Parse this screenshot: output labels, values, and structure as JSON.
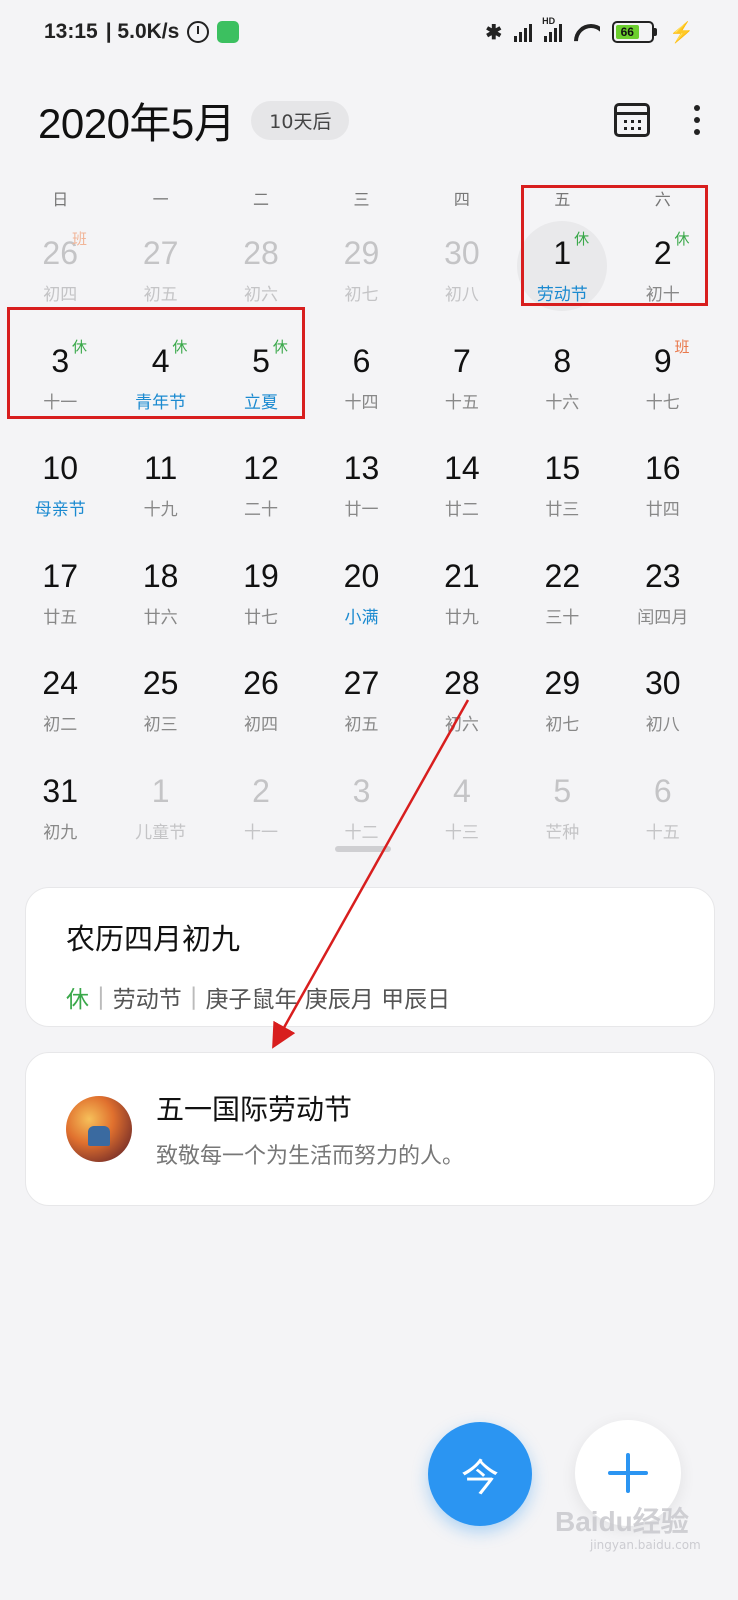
{
  "status_bar": {
    "time": "13:15",
    "net_speed": "| 5.0K/s",
    "battery": "66",
    "hd_label": "HD"
  },
  "header": {
    "title": "2020年5月",
    "countdown": "10天后"
  },
  "weekdays": [
    "日",
    "一",
    "二",
    "三",
    "四",
    "五",
    "六"
  ],
  "weeks": [
    [
      {
        "num": "26",
        "lunar": "初四",
        "tag": "班",
        "other": true
      },
      {
        "num": "27",
        "lunar": "初五",
        "other": true
      },
      {
        "num": "28",
        "lunar": "初六",
        "other": true
      },
      {
        "num": "29",
        "lunar": "初七",
        "other": true
      },
      {
        "num": "30",
        "lunar": "初八",
        "other": true
      },
      {
        "num": "1",
        "lunar": "劳动节",
        "tag": "休",
        "festival": true,
        "selected": true
      },
      {
        "num": "2",
        "lunar": "初十",
        "tag": "休"
      }
    ],
    [
      {
        "num": "3",
        "lunar": "十一",
        "tag": "休"
      },
      {
        "num": "4",
        "lunar": "青年节",
        "tag": "休",
        "festival": true
      },
      {
        "num": "5",
        "lunar": "立夏",
        "tag": "休",
        "festival": true
      },
      {
        "num": "6",
        "lunar": "十四"
      },
      {
        "num": "7",
        "lunar": "十五"
      },
      {
        "num": "8",
        "lunar": "十六"
      },
      {
        "num": "9",
        "lunar": "十七",
        "tag": "班"
      }
    ],
    [
      {
        "num": "10",
        "lunar": "母亲节",
        "festival": true
      },
      {
        "num": "11",
        "lunar": "十九"
      },
      {
        "num": "12",
        "lunar": "二十"
      },
      {
        "num": "13",
        "lunar": "廿一"
      },
      {
        "num": "14",
        "lunar": "廿二"
      },
      {
        "num": "15",
        "lunar": "廿三"
      },
      {
        "num": "16",
        "lunar": "廿四"
      }
    ],
    [
      {
        "num": "17",
        "lunar": "廿五"
      },
      {
        "num": "18",
        "lunar": "廿六"
      },
      {
        "num": "19",
        "lunar": "廿七"
      },
      {
        "num": "20",
        "lunar": "小满",
        "festival": true
      },
      {
        "num": "21",
        "lunar": "廿九"
      },
      {
        "num": "22",
        "lunar": "三十"
      },
      {
        "num": "23",
        "lunar": "闰四月"
      }
    ],
    [
      {
        "num": "24",
        "lunar": "初二"
      },
      {
        "num": "25",
        "lunar": "初三"
      },
      {
        "num": "26",
        "lunar": "初四"
      },
      {
        "num": "27",
        "lunar": "初五"
      },
      {
        "num": "28",
        "lunar": "初六"
      },
      {
        "num": "29",
        "lunar": "初七"
      },
      {
        "num": "30",
        "lunar": "初八"
      }
    ],
    [
      {
        "num": "31",
        "lunar": "初九"
      },
      {
        "num": "1",
        "lunar": "儿童节",
        "other": true
      },
      {
        "num": "2",
        "lunar": "十一",
        "other": true
      },
      {
        "num": "3",
        "lunar": "十二",
        "other": true
      },
      {
        "num": "4",
        "lunar": "十三",
        "other": true
      },
      {
        "num": "5",
        "lunar": "芒种",
        "other": true
      },
      {
        "num": "6",
        "lunar": "十五",
        "other": true
      }
    ]
  ],
  "lunar_card": {
    "title": "农历四月初九",
    "rest": "休",
    "festival": "劳动节",
    "ganzhi": "庚子鼠年 庚辰月 甲辰日"
  },
  "holiday_card": {
    "title": "五一国际劳动节",
    "subtitle": "致敬每一个为生活而努力的人。"
  },
  "fab": {
    "today": "今"
  },
  "watermark": {
    "brand": "Baidu经验",
    "url": "jingyan.baidu.com"
  },
  "colors": {
    "accent": "#2b95f2",
    "rest": "#3aa84a",
    "work": "#e9794c",
    "festival": "#1b8ad0",
    "highlight": "#d81e1e"
  }
}
